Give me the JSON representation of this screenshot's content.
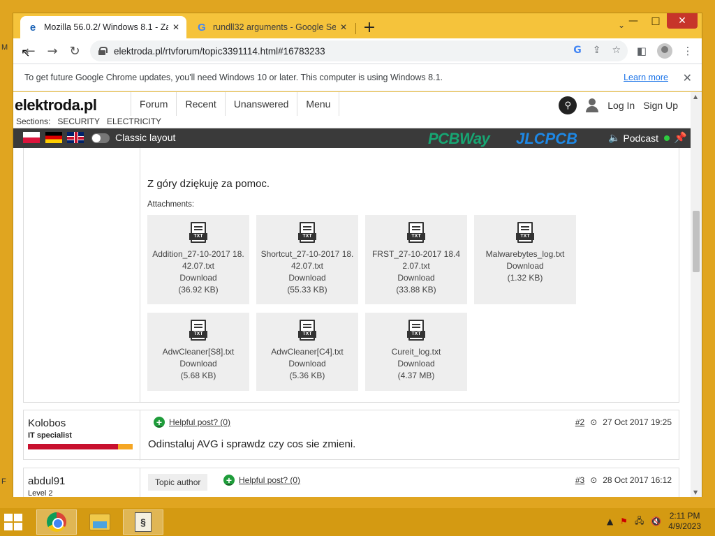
{
  "browser": {
    "tabs": [
      {
        "title": "Mozilla 56.0.2/ Windows 8.1 - Za",
        "favicon": "e"
      },
      {
        "title": "rundll32 arguments - Google Se",
        "favicon": "G"
      }
    ],
    "url": "elektroda.pl/rtvforum/topic3391114.html#16783233",
    "infobar": {
      "message": "To get future Google Chrome updates, you'll need Windows 10 or later. This computer is using Windows 8.1.",
      "link": "Learn more"
    }
  },
  "site": {
    "logo": "elektroda.pl",
    "nav": [
      "Forum",
      "Recent",
      "Unanswered",
      "Menu"
    ],
    "login": "Log In",
    "signup": "Sign Up",
    "sections_label": "Sections:",
    "sections": [
      "SECURITY",
      "ELECTRICITY"
    ],
    "classic_layout": "Classic layout",
    "sponsor1": "PCBWay",
    "sponsor2": "JLCPCB",
    "podcast": "Podcast"
  },
  "post": {
    "thanks": "Z góry dziękuję za pomoc.",
    "attachments_label": "Attachments:",
    "attachments": [
      {
        "name": "Addition_27-10-2017 18.42.07.txt",
        "download": "Download",
        "size": "(36.92 KB)"
      },
      {
        "name": "Shortcut_27-10-2017 18.42.07.txt",
        "download": "Download",
        "size": "(55.33 KB)"
      },
      {
        "name": "FRST_27-10-2017 18.42.07.txt",
        "download": "Download",
        "size": "(33.88 KB)"
      },
      {
        "name": "Malwarebytes_log.txt",
        "download": "Download",
        "size": "(1.32 KB)"
      },
      {
        "name": "AdwCleaner[S8].txt",
        "download": "Download",
        "size": "(5.68 KB)"
      },
      {
        "name": "AdwCleaner[C4].txt",
        "download": "Download",
        "size": "(5.36 KB)"
      },
      {
        "name": "Cureit_log.txt",
        "download": "Download",
        "size": "(4.37 MB)"
      }
    ]
  },
  "replies": [
    {
      "user": "Kolobos",
      "rank": "IT specialist",
      "helpful": "Helpful post? (0)",
      "num": "#2",
      "date": "27 Oct 2017 19:25",
      "text": "Odinstaluj AVG i sprawdz czy cos sie zmieni.",
      "reputation_color": "#c8102e"
    },
    {
      "user": "abdul91",
      "rank": "Level 2",
      "topic_author": "Topic author",
      "helpful": "Helpful post? (0)",
      "num": "#3",
      "date": "28 Oct 2017 16:12",
      "reputation_color": "#1e9c3a"
    }
  ],
  "taskbar": {
    "time": "2:11 PM",
    "date": "4/9/2023"
  }
}
